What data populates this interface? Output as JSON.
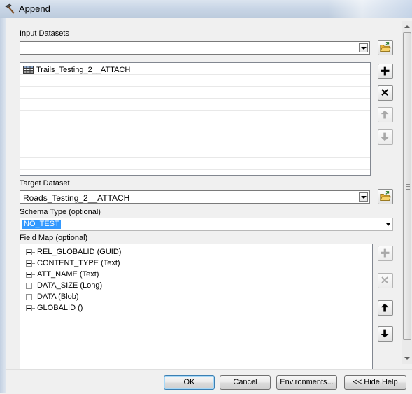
{
  "window": {
    "title": "Append"
  },
  "input_datasets": {
    "label": "Input Datasets",
    "combo_value": "",
    "items": [
      {
        "label": "Trails_Testing_2__ATTACH",
        "icon": "table-icon"
      }
    ]
  },
  "target_dataset": {
    "label": "Target Dataset",
    "value": "Roads_Testing_2__ATTACH"
  },
  "schema_type": {
    "label": "Schema Type (optional)",
    "value": "NO_TEST"
  },
  "field_map": {
    "label": "Field Map (optional)",
    "fields": [
      "REL_GLOBALID (GUID)",
      "CONTENT_TYPE (Text)",
      "ATT_NAME (Text)",
      "DATA_SIZE (Long)",
      "DATA (Blob)",
      "GLOBALID ()"
    ]
  },
  "buttons": {
    "ok": "OK",
    "cancel": "Cancel",
    "environments": "Environments...",
    "hide_help": "<< Hide Help"
  },
  "colors": {
    "selection": "#3399ff",
    "add_green": "#000000",
    "folder_yellow": "#f2c94c"
  }
}
